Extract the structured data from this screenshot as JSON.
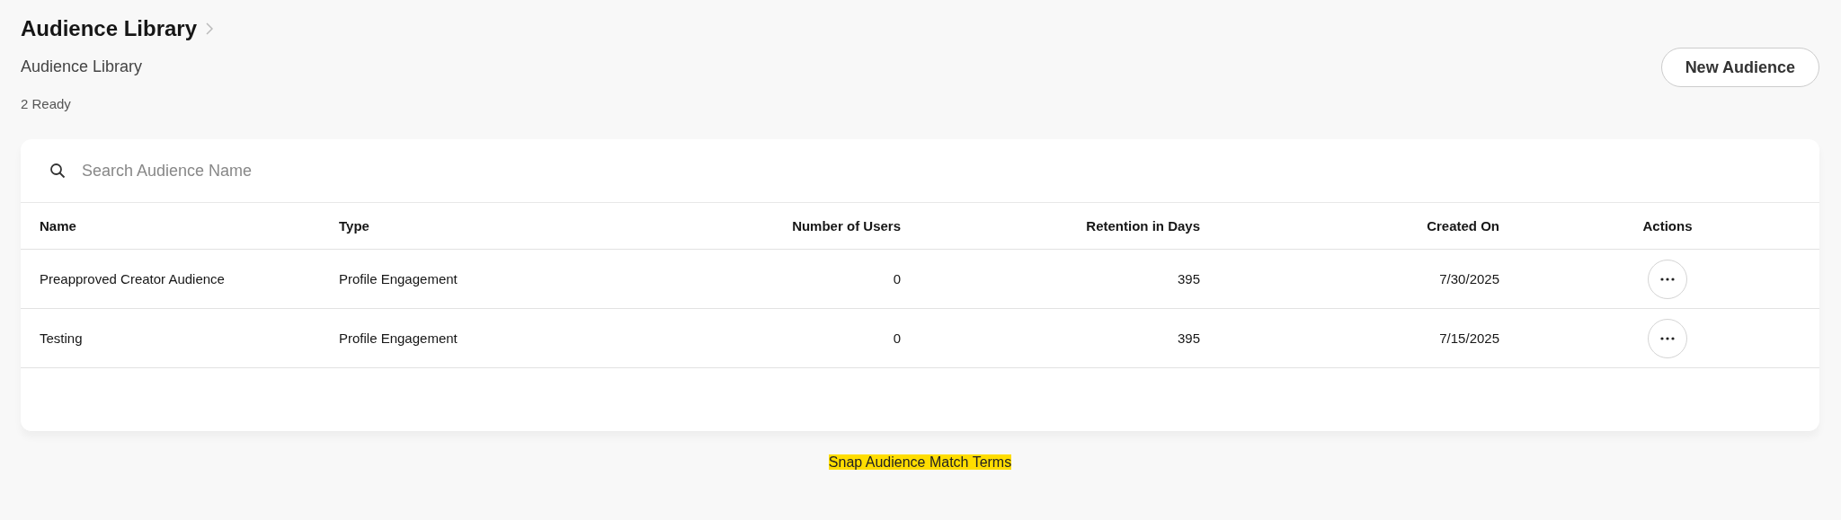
{
  "header": {
    "title": "Audience Library",
    "subtitle": "Audience Library",
    "status": "2 Ready",
    "new_button": "New Audience"
  },
  "search": {
    "placeholder": "Search Audience Name"
  },
  "table": {
    "columns": [
      "Name",
      "Type",
      "Number of Users",
      "Retention in Days",
      "Created On",
      "Actions"
    ],
    "rows": [
      {
        "name": "Preapproved Creator Audience",
        "type": "Profile Engagement",
        "users": "0",
        "retention": "395",
        "created": "7/30/2025"
      },
      {
        "name": "Testing",
        "type": "Profile Engagement",
        "users": "0",
        "retention": "395",
        "created": "7/15/2025"
      }
    ]
  },
  "footer_link": "Snap Audience Match Terms"
}
